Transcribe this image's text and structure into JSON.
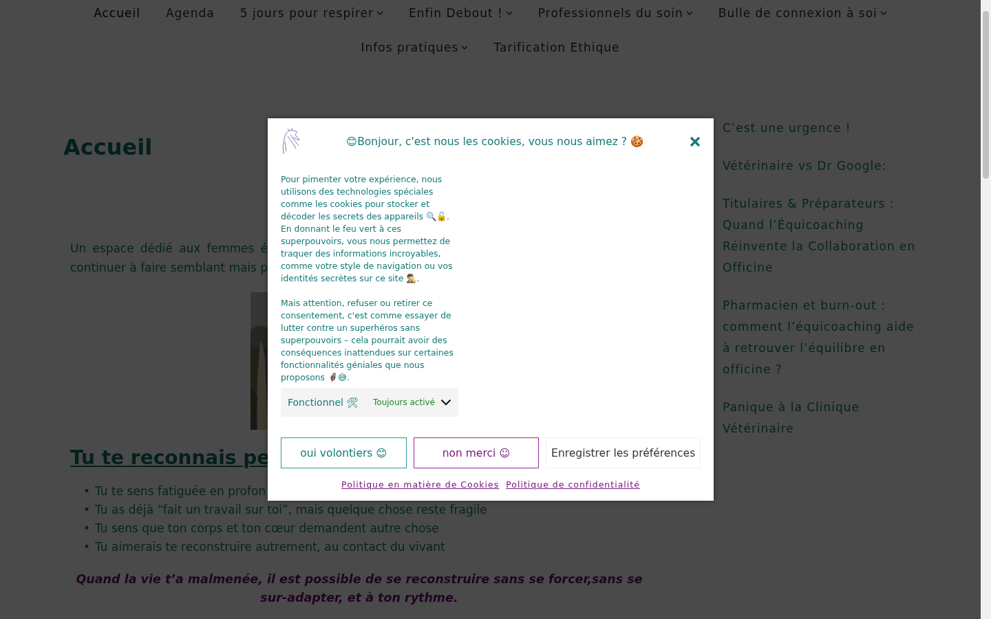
{
  "nav": {
    "items": [
      {
        "label": "Accueil",
        "selected": true,
        "has_dropdown": false
      },
      {
        "label": "Agenda",
        "selected": false,
        "has_dropdown": false
      },
      {
        "label": "5 jours pour respirer",
        "selected": false,
        "has_dropdown": true
      },
      {
        "label": "Enfin Debout !",
        "selected": false,
        "has_dropdown": true
      },
      {
        "label": "Professionnels du soin",
        "selected": false,
        "has_dropdown": true
      },
      {
        "label": "Bulle de connexion à soi",
        "selected": false,
        "has_dropdown": true
      },
      {
        "label": "Infos pratiques",
        "selected": false,
        "has_dropdown": true
      },
      {
        "label": "Tarification Ethique",
        "selected": false,
        "has_dropdown": false
      }
    ]
  },
  "page": {
    "title": "Accueil",
    "intro_lines": [
      "Un espace dédié aux femmes é",
      "continuer à faire semblant mais p"
    ],
    "photo": {
      "kind": "picture"
    },
    "section_heading": "Tu te reconnais pe",
    "bullets": [
      {
        "marker": "•",
        "text": "Tu te sens fatiguée en profon"
      },
      {
        "marker": "•",
        "text": "Tu as déjà “fait un travail sur toi”, mais quelque chose reste fragile"
      },
      {
        "marker": "•",
        "text": "Tu sens que ton corps et ton cœur demandent autre chose"
      },
      {
        "marker": "•",
        "text": "Tu aimerais te reconstruire autrement, au contact du vivant"
      }
    ],
    "quote_lines": [
      "Quand la vie t’a malmenée, il est possible de se reconstruire sans se forcer,sans se",
      "sur-adapter, et à ton rythme."
    ]
  },
  "sidebar": {
    "posts": [
      "C’est une urgence !",
      "Vétérinaire vs Dr Google:",
      "Titulaires & Préparateurs : Quand l’Équicoaching Réinvente la Collaboration en Officine",
      "Pharmacien et burn-out : comment l’équicoaching aide à retrouver l’équilibre en officine ?",
      "Panique à la Clinique Vétérinaire"
    ]
  },
  "cookie_dialog": {
    "title": "😊Bonjour, c'est nous les cookies, vous nous aimez ? 🍪",
    "paragraphs": [
      "Pour pimenter votre expérience, nous utilisons des technologies spéciales comme les cookies pour stocker et décoder les secrets des appareils 🔍🔓. En donnant le feu vert à ces superpouvoirs, vous nous permettez de traquer des informations incroyables, comme votre style de navigation ou vos identités secrètes sur ce site 🕵‍♂.",
      "Mais attention, refuser ou retirer ce consentement, c'est comme essayer de lutter contre un superhéros sans superpouvoirs – cela pourrait avoir des conséquences inattendues sur certaines fonctionnalités géniales que nous proposons 🦸😅."
    ],
    "category": {
      "label": "Fonctionnel 🛠",
      "status": "Toujours activé",
      "expanded": false
    },
    "buttons": [
      {
        "label": "oui volontiers 😊",
        "kind": "accept"
      },
      {
        "label": "non merci ☺",
        "kind": "deny"
      },
      {
        "label": "Enregistrer les préférences",
        "kind": "save"
      }
    ],
    "links": [
      "Politique en matière de Cookies",
      "Politique de confidentialité"
    ]
  }
}
